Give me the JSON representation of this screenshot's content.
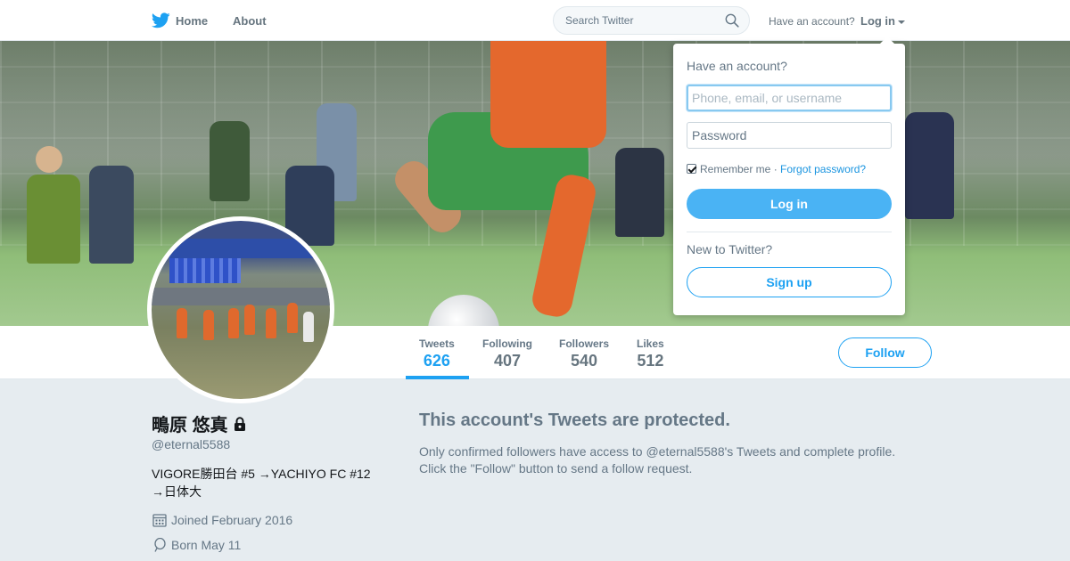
{
  "nav": {
    "home_label": "Home",
    "about_label": "About",
    "search_placeholder": "Search Twitter",
    "have_account": "Have an account?",
    "login_label": "Log in"
  },
  "login_dropdown": {
    "heading": "Have an account?",
    "username_placeholder": "Phone, email, or username",
    "password_placeholder": "Password",
    "remember_me": "Remember me",
    "separator": "·",
    "forgot_password": "Forgot password?",
    "login_button": "Log in",
    "new_to_twitter": "New to Twitter?",
    "signup_button": "Sign up"
  },
  "stats": [
    {
      "label": "Tweets",
      "value": "626",
      "active": true
    },
    {
      "label": "Following",
      "value": "407",
      "active": false
    },
    {
      "label": "Followers",
      "value": "540",
      "active": false
    },
    {
      "label": "Likes",
      "value": "512",
      "active": false
    }
  ],
  "follow_button": "Follow",
  "profile": {
    "name": "鴫原 悠真",
    "handle": "@eternal5588",
    "bio_line1": "VIGORE勝田台 #5 →YACHIYO FC #12",
    "bio_line2": "→日体大",
    "joined": "Joined February 2016",
    "born": "Born May 11",
    "protected": true
  },
  "protected_message": {
    "title": "This account's Tweets are protected.",
    "line1": "Only confirmed followers have access to @eternal5588's Tweets and complete profile.",
    "line2": "Click the \"Follow\" button to send a follow request."
  },
  "colors": {
    "accent": "#1da1f2",
    "background": "#e6ecf0",
    "muted_text": "#657786"
  }
}
